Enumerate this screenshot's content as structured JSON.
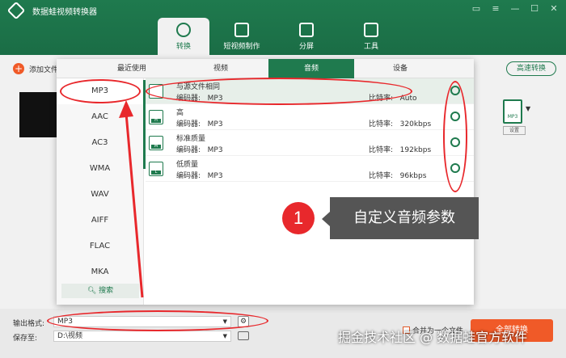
{
  "app": {
    "title": "数据蛙视频转换器"
  },
  "nav": {
    "tabs": [
      {
        "label": "转换",
        "icon": "convert-icon"
      },
      {
        "label": "短视频制作",
        "icon": "video-maker-icon"
      },
      {
        "label": "分屏",
        "icon": "split-screen-icon"
      },
      {
        "label": "工具",
        "icon": "toolbox-icon"
      }
    ]
  },
  "toolbar": {
    "add_file": "添加文件",
    "speed_convert": "高速转换"
  },
  "output_format_btn": {
    "badge": "MP3",
    "label": "设置"
  },
  "popup": {
    "tabs": [
      "最近使用",
      "视频",
      "音频",
      "设备"
    ],
    "active_tab": "音频",
    "formats": [
      "MP3",
      "AAC",
      "AC3",
      "WMA",
      "WAV",
      "AIFF",
      "FLAC",
      "MKA"
    ],
    "active_format": "MP3",
    "search_label": "搜索",
    "presets": [
      {
        "name": "与源文件相同",
        "encoder_label": "编码器:",
        "encoder": "MP3",
        "bitrate_label": "比特率:",
        "bitrate": "Auto",
        "badge": ""
      },
      {
        "name": "高",
        "encoder_label": "编码器:",
        "encoder": "MP3",
        "bitrate_label": "比特率:",
        "bitrate": "320kbps",
        "badge": "H"
      },
      {
        "name": "标准质量",
        "encoder_label": "编码器:",
        "encoder": "MP3",
        "bitrate_label": "比特率:",
        "bitrate": "192kbps",
        "badge": "M"
      },
      {
        "name": "低质量",
        "encoder_label": "编码器:",
        "encoder": "MP3",
        "bitrate_label": "比特率:",
        "bitrate": "96kbps",
        "badge": "L"
      }
    ]
  },
  "bottom": {
    "output_format_label": "输出格式:",
    "output_format_value": "MP3",
    "save_to_label": "保存至:",
    "save_to_value": "D:\\视频",
    "merge_label": "合并为一个文件",
    "convert_all": "全部转换"
  },
  "annotation": {
    "number": "1",
    "text": "自定义音频参数",
    "color": "#e8282c"
  },
  "watermark": "掘金技术社区 @ 数据蛙官方软件",
  "colors": {
    "brand": "#1f7a4e",
    "accent": "#f05a28"
  }
}
